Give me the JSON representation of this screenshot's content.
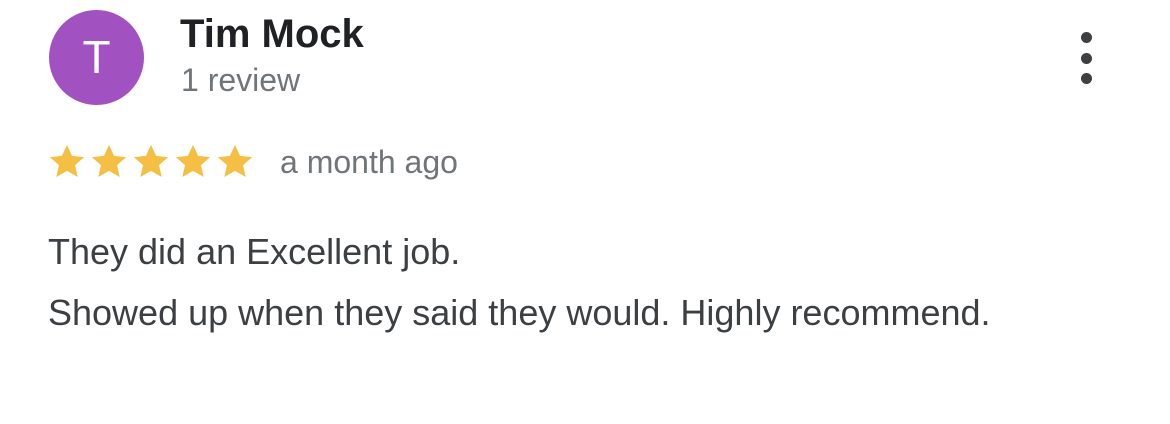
{
  "reviewer": {
    "avatar_initial": "T",
    "avatar_color": "#a251c1",
    "name": "Tim Mock",
    "review_count": "1 review"
  },
  "menu": {
    "icon": "more-vert-icon"
  },
  "rating": {
    "stars": 5,
    "max_stars": 5,
    "star_color": "#f4bf42",
    "time": "a month ago"
  },
  "review": {
    "lines": [
      "They did an Excellent job.",
      "Showed up when they said they would. Highly recommend."
    ]
  }
}
